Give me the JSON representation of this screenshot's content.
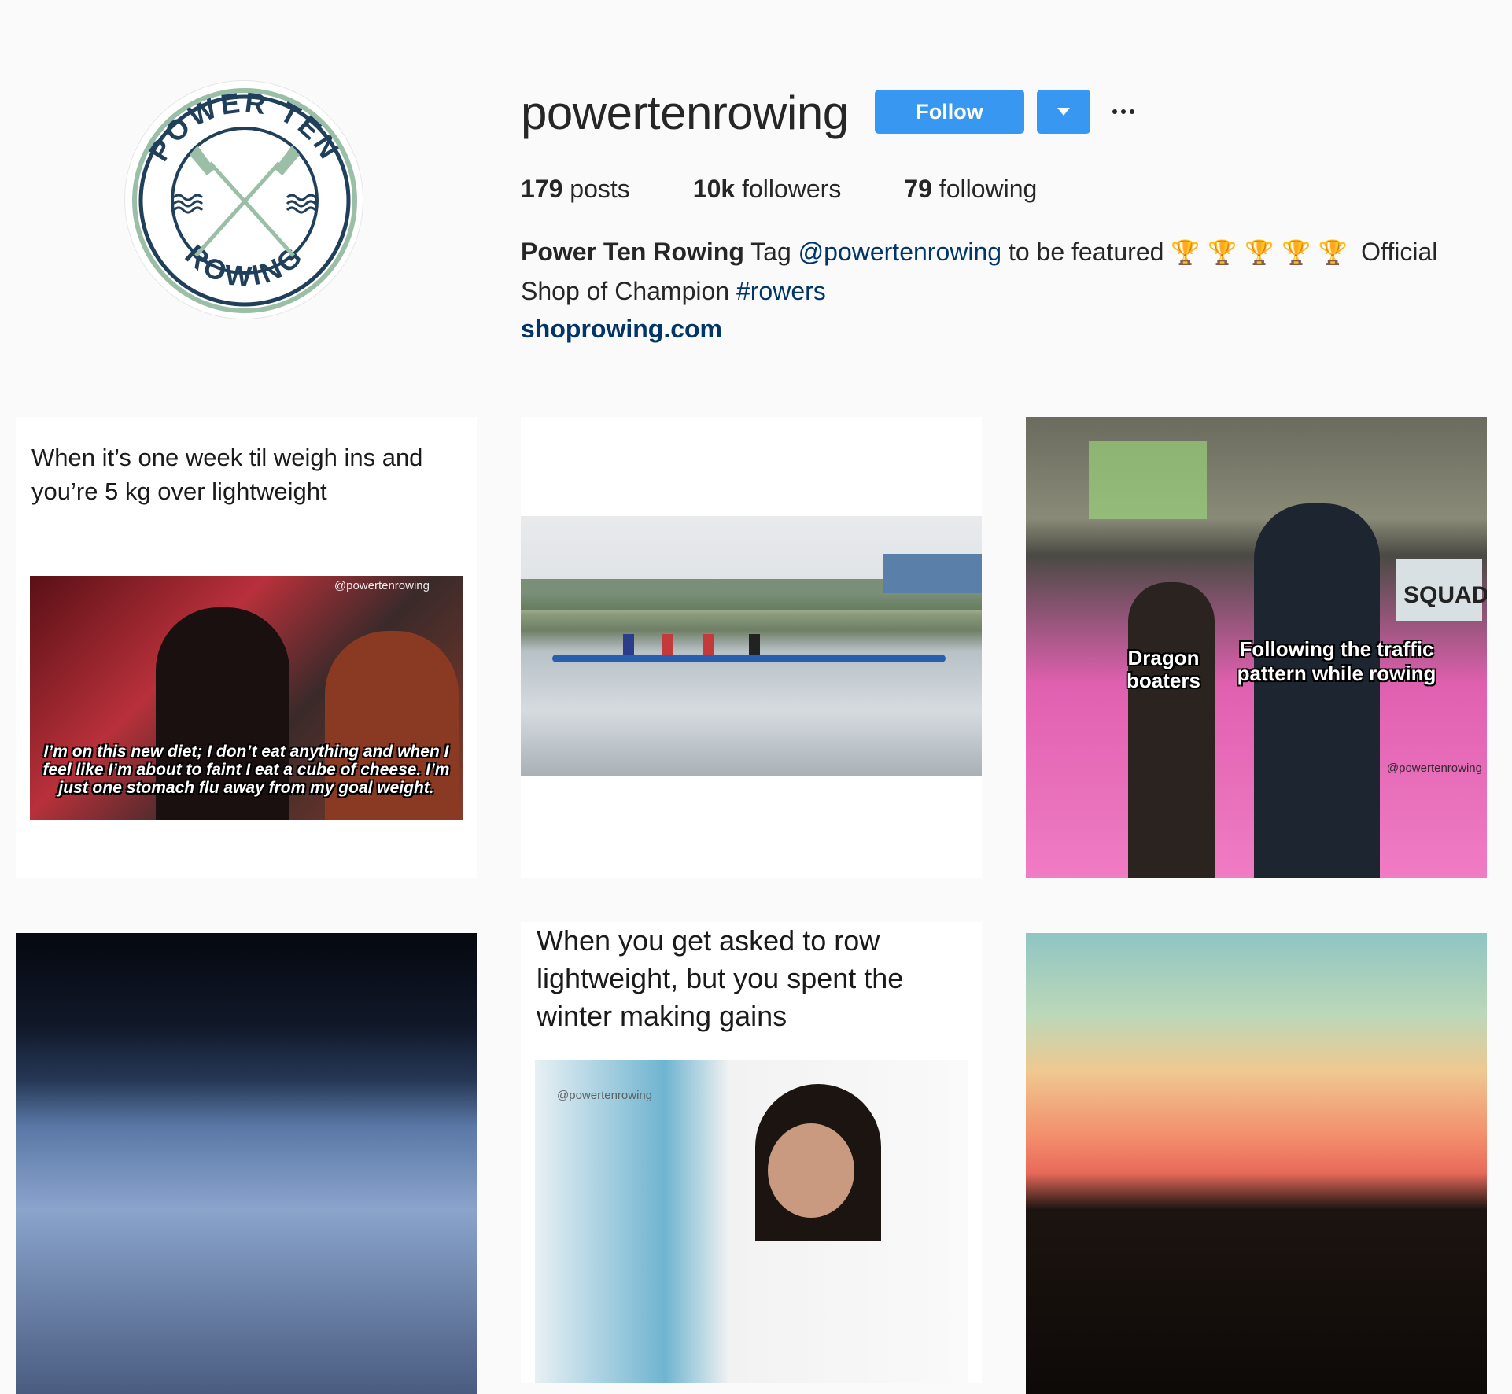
{
  "profile": {
    "username": "powertenrowing",
    "follow_label": "Follow",
    "avatar": {
      "top_text": "POWER TEN",
      "bottom_text": "ROWING",
      "colors": {
        "ring": "#1f3f5b",
        "oars": "#9bbfa6"
      }
    }
  },
  "stats": {
    "posts_count": "179",
    "posts_label": "posts",
    "followers_count": "10k",
    "followers_label": "followers",
    "following_count": "79",
    "following_label": "following"
  },
  "bio": {
    "name": "Power Ten Rowing",
    "text_1": "Tag",
    "mention": "@powertenrowing",
    "text_2": "to be featured",
    "trophies": "🏆 🏆 🏆 🏆 🏆",
    "text_3": "Official Shop of Champion",
    "hashtag": "#rowers",
    "website": "shoprowing.com"
  },
  "posts": [
    {
      "caption": "When it’s one week til weigh ins and you’re 5 kg over lightweight",
      "watermark": "@powertenrowing",
      "meme_text": "I’m on this new diet; I don’t eat anything and when I feel like I’m about to faint I eat a cube of cheese. I’m just one stomach flu away from my goal weight."
    },
    {
      "caption": ""
    },
    {
      "label_left": "Dragon boaters",
      "label_right": "Following the traffic pattern while rowing",
      "watermark": "@powertenrowing",
      "sign_text": "SQUAD"
    },
    {
      "caption": ""
    },
    {
      "caption": "When you get asked to row lightweight, but you spent the winter making gains",
      "watermark": "@powertenrowing"
    },
    {
      "caption": ""
    }
  ],
  "colors": {
    "accent": "#3897f0",
    "link": "#003569",
    "background": "#fafafa"
  }
}
